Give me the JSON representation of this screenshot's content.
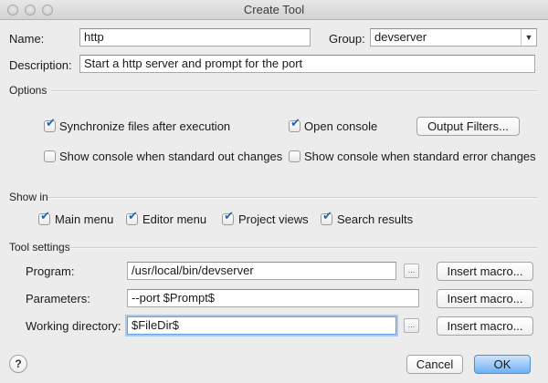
{
  "window": {
    "title": "Create Tool"
  },
  "form": {
    "name_label": "Name:",
    "name_value": "http",
    "group_label": "Group:",
    "group_value": "devserver",
    "description_label": "Description:",
    "description_value": "Start a http server and prompt for the port"
  },
  "options": {
    "heading": "Options",
    "sync_files": {
      "label": "Synchronize files after execution",
      "checked": true
    },
    "open_console": {
      "label": "Open console",
      "checked": true
    },
    "output_filters_label": "Output Filters...",
    "show_console_stdout": {
      "label": "Show console when standard out changes",
      "checked": false
    },
    "show_console_stderr": {
      "label": "Show console when standard error changes",
      "checked": false
    }
  },
  "show_in": {
    "heading": "Show in",
    "main_menu": {
      "label": "Main menu",
      "checked": true
    },
    "editor_menu": {
      "label": "Editor menu",
      "checked": true
    },
    "project_views": {
      "label": "Project views",
      "checked": true
    },
    "search_results": {
      "label": "Search results",
      "checked": true
    }
  },
  "tool_settings": {
    "heading": "Tool settings",
    "program_label": "Program:",
    "program_value": "/usr/local/bin/devserver",
    "parameters_label": "Parameters:",
    "parameters_value": "--port $Prompt$",
    "working_dir_label": "Working directory:",
    "working_dir_value": "$FileDir$",
    "insert_macro_label": "Insert macro...",
    "browse_label": "..."
  },
  "footer": {
    "help_label": "?",
    "cancel_label": "Cancel",
    "ok_label": "OK"
  }
}
